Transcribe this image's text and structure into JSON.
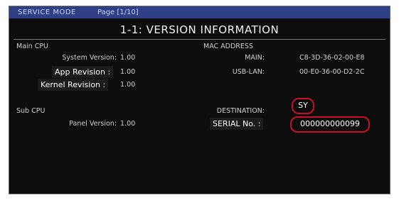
{
  "header": {
    "mode": "SERVICE MODE",
    "page": "Page [1/10]"
  },
  "title": "1-1: VERSION INFORMATION",
  "main_cpu": {
    "heading": "Main CPU",
    "system_version_label": "System Version:",
    "system_version_value": "1.00",
    "app_revision_label": "App Revision :",
    "app_revision_value": "1.00",
    "kernel_revision_label": "Kernel Revision :",
    "kernel_revision_value": "1.00"
  },
  "sub_cpu": {
    "heading": "Sub CPU",
    "panel_version_label": "Panel Version:",
    "panel_version_value": "1.00"
  },
  "mac_address": {
    "heading": "MAC ADDRESS",
    "main_label": "MAIN:",
    "main_value": "C8-3D-36-02-00-E8",
    "usb_lan_label": "USB-LAN:",
    "usb_lan_value": "00-E0-36-00-D2-2C"
  },
  "destination": {
    "label": "DESTINATION:",
    "value": "SY"
  },
  "serial": {
    "label": "SERIAL No. :",
    "value": "000000000099"
  },
  "colors": {
    "header_bar": "#2f3f86",
    "highlight_circle": "#c8102e",
    "screen_bg": "#0d0d0d"
  }
}
